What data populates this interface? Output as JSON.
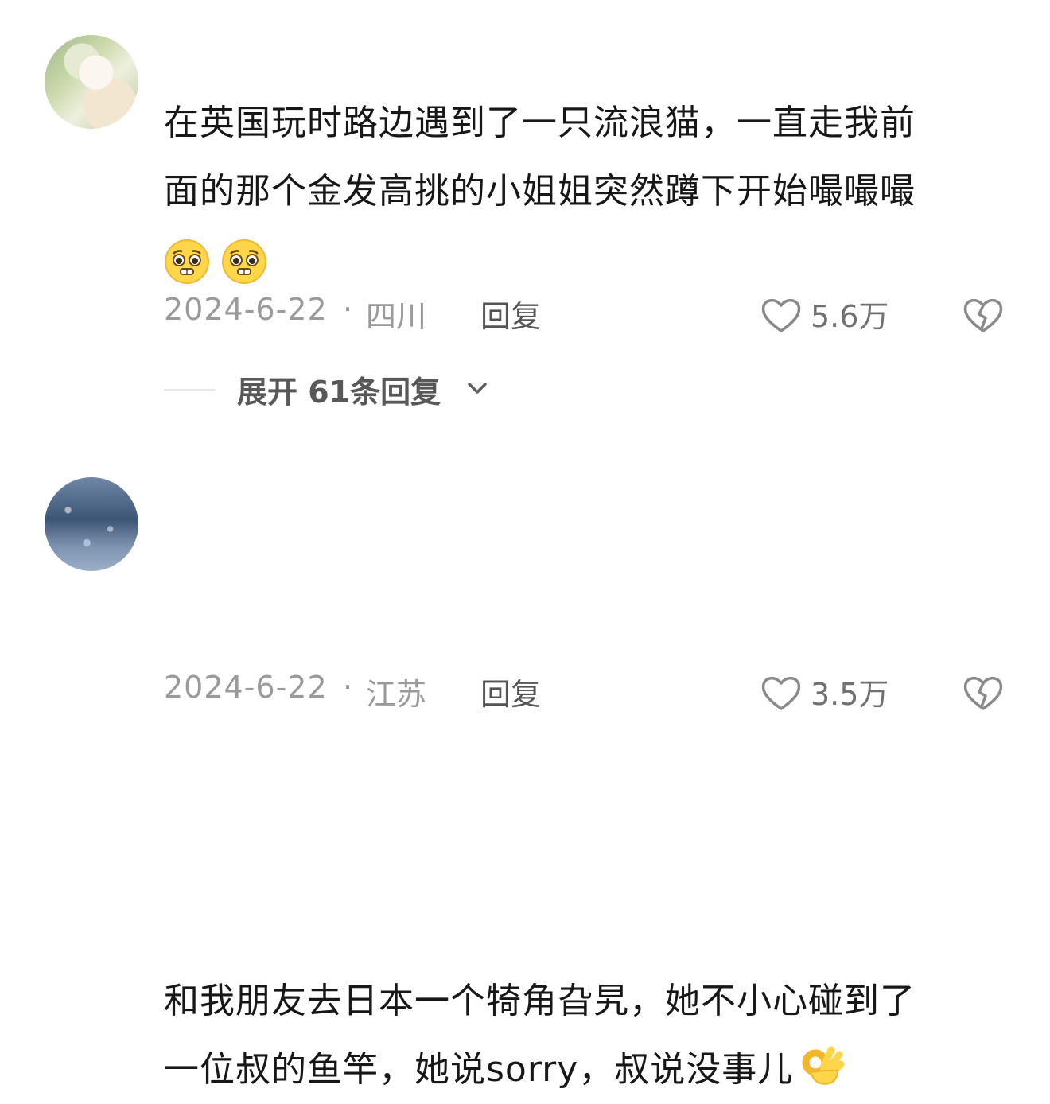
{
  "comments": [
    {
      "avatar_icon": "anime-avatar-icon",
      "text_lines": [
        "在英国玩时路边遇到了一只流浪猫，一直走我前",
        "面的那个金发高挑的小姐姐突然蹲下开始嘬嘬嘬"
      ],
      "emojis": [
        "pleading-face-icon",
        "pleading-face-icon"
      ],
      "date": "2024-6-22",
      "separator": "·",
      "location": "四川",
      "reply_label": "回复",
      "like_count": "5.6万",
      "expand_label": "展开 61条回复"
    },
    {
      "avatar_icon": "night-city-avatar-icon",
      "text_lines": [
        "和我朋友去日本一个犄角旮旯，她不小心碰到了",
        "一位叔的鱼竿，她说sorry，叔说没事儿"
      ],
      "trailing_emoji": "ok-hand-icon",
      "date": "2024-6-22",
      "separator": "·",
      "location": "江苏",
      "reply_label": "回复",
      "like_count": "3.5万"
    }
  ],
  "colors": {
    "text": "#171717",
    "meta": "#9a9a9a",
    "emoji_yellow": "#ffd54a"
  }
}
